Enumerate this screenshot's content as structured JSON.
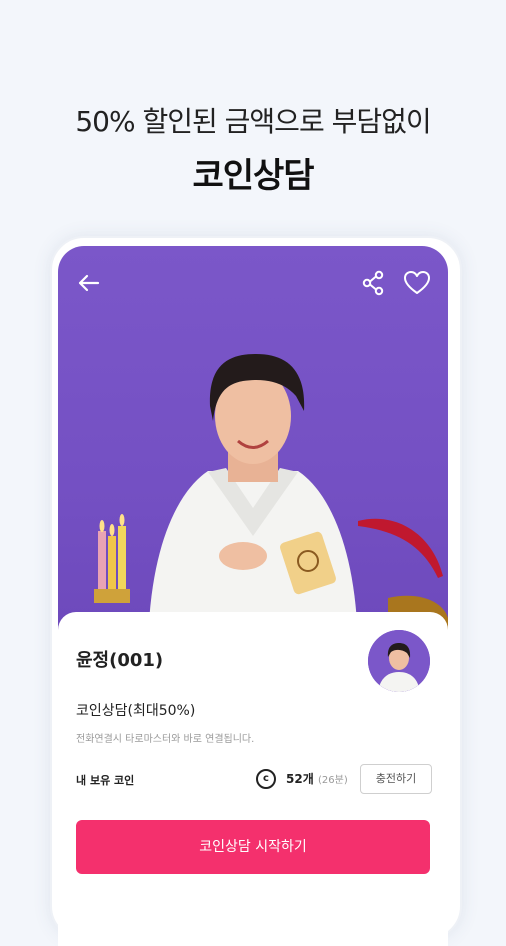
{
  "headline": {
    "line1": "50% 할인된 금액으로 부담없이",
    "line2": "코인상담"
  },
  "topbar": {
    "back_icon": "arrow-left-icon",
    "share_icon": "share-icon",
    "favorite_icon": "heart-icon"
  },
  "profile": {
    "name": "윤정(001)",
    "subtitle": "코인상담(최대50%)",
    "description": "전화연결시 타로마스터와 바로 연결됩니다."
  },
  "coins": {
    "label": "내 보유 코인",
    "icon": "copyright-coin-icon",
    "symbol": "c",
    "count": "52개",
    "minutes": "(26분)",
    "charge_label": "충전하기"
  },
  "cta": {
    "start_label": "코인상담 시작하기",
    "color": "#f4306d"
  },
  "colors": {
    "hero_bg": "#7450c3",
    "page_bg": "#f3f6fb"
  }
}
